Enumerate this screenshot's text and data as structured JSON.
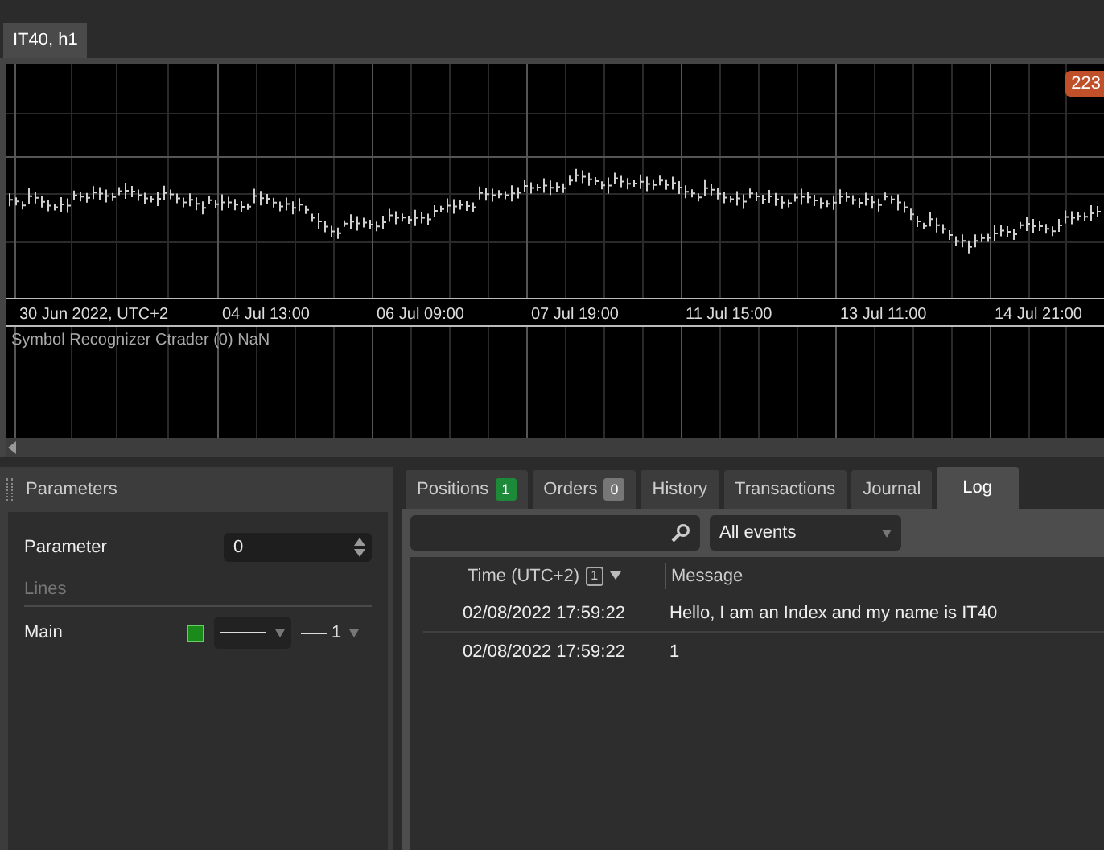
{
  "chart_tab": {
    "label": "IT40, h1",
    "selected": true
  },
  "chart": {
    "price_badge": "223",
    "time_labels": [
      "30 Jun 2022, UTC+2",
      "04 Jul 13:00",
      "06 Jul 09:00",
      "07 Jul 19:00",
      "11 Jul 15:00",
      "13 Jul 11:00",
      "14 Jul 21:00"
    ],
    "indicator_label": "Symbol Recognizer Ctrader (0) NaN"
  },
  "parameters": {
    "title": "Parameters",
    "rows": [
      {
        "kind": "number",
        "label": "Parameter",
        "value": "0"
      },
      {
        "kind": "section",
        "label": "Lines"
      },
      {
        "kind": "line",
        "label": "Main",
        "color": "#1a8a1a",
        "thickness": "1"
      }
    ]
  },
  "tabs": [
    {
      "label": "Positions",
      "badge": "1",
      "color": "#1d8a3a",
      "selected": false
    },
    {
      "label": "Orders",
      "badge": "0",
      "color": "#777777",
      "selected": false
    },
    {
      "label": "History",
      "selected": false
    },
    {
      "label": "Transactions",
      "selected": false
    },
    {
      "label": "Journal",
      "selected": false
    },
    {
      "label": "Log",
      "selected": true
    }
  ],
  "filter": {
    "value": "All events"
  },
  "log": {
    "columns": [
      {
        "label": "Time (UTC+2)",
        "sort_index": "1"
      },
      {
        "label": "Message"
      }
    ],
    "rows": [
      {
        "time": "02/08/2022 17:59:22",
        "message": "Hello, I am an Index and my name is IT40"
      },
      {
        "time": "02/08/2022 17:59:22",
        "message": "1"
      }
    ]
  }
}
